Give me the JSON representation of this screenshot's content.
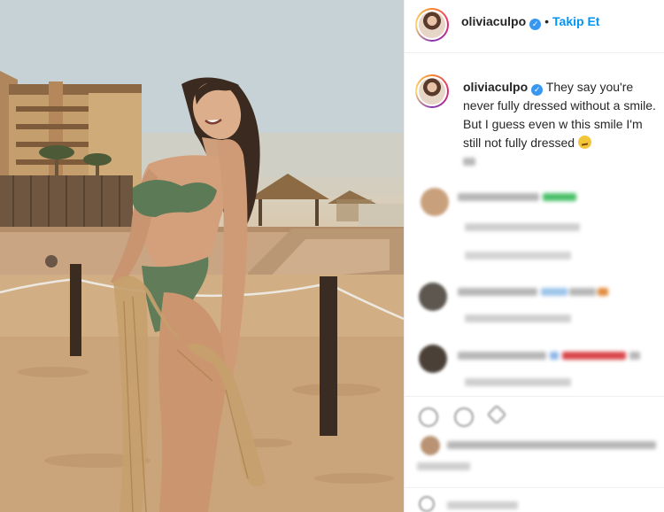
{
  "post": {
    "username": "oliviaculpo",
    "follow_label": "Takip Et",
    "caption_text": "They say you're never fully dressed without a smile. But I guess even w this smile I'm still not fully dressed",
    "caption_emoji": "thinking-face-emoji"
  },
  "icons": {
    "verified": "verified-badge-icon",
    "like": "heart-icon",
    "comment": "comment-icon",
    "share": "share-icon"
  },
  "colors": {
    "follow_blue": "#0095f6",
    "verified_blue": "#3897f0",
    "divider": "#efefef"
  }
}
